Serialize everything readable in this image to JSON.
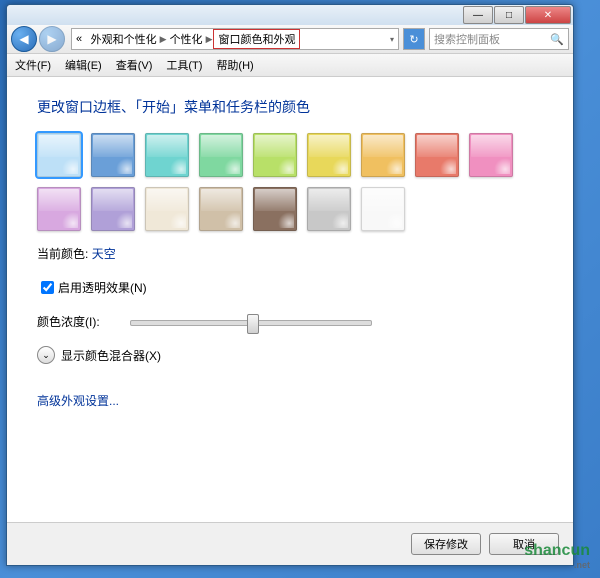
{
  "titlebar": {
    "min": "—",
    "max": "□",
    "close": "✕"
  },
  "nav": {
    "back": "◀",
    "forward": "▶",
    "refresh": "↻",
    "search_icon": "🔍"
  },
  "breadcrumb": {
    "prefix": "«",
    "items": [
      "外观和个性化",
      "个性化",
      "窗口颜色和外观"
    ]
  },
  "search": {
    "placeholder": "搜索控制面板"
  },
  "menu": [
    "文件(F)",
    "编辑(E)",
    "查看(V)",
    "工具(T)",
    "帮助(H)"
  ],
  "content": {
    "heading": "更改窗口边框、「开始」菜单和任务栏的颜色",
    "colors": [
      {
        "hex": "#bde0f7",
        "sel": true
      },
      {
        "hex": "#6a9fd8"
      },
      {
        "hex": "#6fd4d0"
      },
      {
        "hex": "#7fd8a0"
      },
      {
        "hex": "#b8e068"
      },
      {
        "hex": "#e8d85a"
      },
      {
        "hex": "#f0c060"
      },
      {
        "hex": "#e87a6a"
      },
      {
        "hex": "#f090c0"
      },
      {
        "hex": "#d8a8e0"
      },
      {
        "hex": "#b0a0d8"
      },
      {
        "hex": "#f0e8d8"
      },
      {
        "hex": "#d0c0a8"
      },
      {
        "hex": "#8a7060"
      },
      {
        "hex": "#c8c8c8"
      },
      {
        "hex": "#f8f8f8"
      }
    ],
    "current_label": "当前颜色:",
    "current_value": "天空",
    "transparency_label": "启用透明效果(N)",
    "transparency_checked": true,
    "intensity_label": "颜色浓度(I):",
    "mixer_label": "显示颜色混合器(X)",
    "mixer_arrow": "⌄",
    "advanced_link": "高级外观设置..."
  },
  "footer": {
    "save": "保存修改",
    "cancel": "取消"
  },
  "watermark": {
    "main": "shancun",
    "sub": ".net"
  }
}
